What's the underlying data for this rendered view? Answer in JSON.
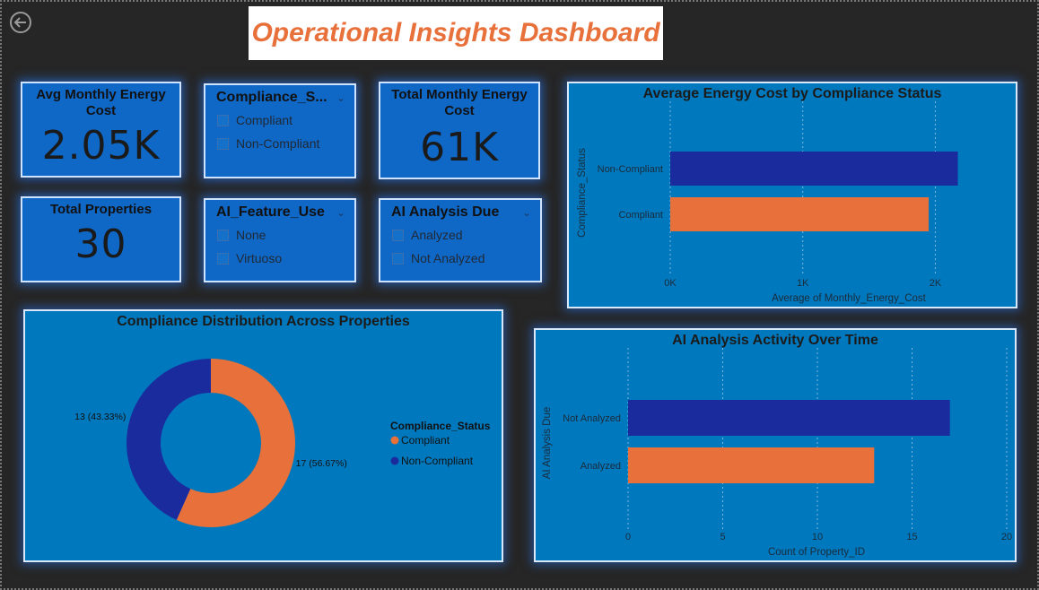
{
  "page_title": "Operational Insights Dashboard",
  "kpis": {
    "avg_energy": {
      "label": "Avg Monthly Energy Cost",
      "value": "2.05K"
    },
    "total_energy": {
      "label": "Total Monthly Energy Cost",
      "value": "61K"
    },
    "total_properties": {
      "label": "Total Properties",
      "value": "30"
    }
  },
  "slicers": {
    "compliance": {
      "title": "Compliance_S...",
      "options": [
        "Compliant",
        "Non-Compliant"
      ]
    },
    "ai_feature": {
      "title": "AI_Feature_Use",
      "options": [
        "None",
        "Virtuoso"
      ]
    },
    "ai_due": {
      "title": "AI Analysis Due",
      "options": [
        "Analyzed",
        "Not Analyzed"
      ]
    }
  },
  "colors": {
    "orange": "#e8703a",
    "navy": "#1a2b9e",
    "visual_bg": "#0078bd",
    "card_bg": "#0f67c6"
  },
  "chart_data": [
    {
      "type": "bar",
      "orientation": "horizontal",
      "title": "Average Energy Cost by Compliance Status",
      "xlabel": "Average of Monthly_Energy_Cost",
      "ylabel": "Compliance_Status",
      "categories": [
        "Non-Compliant",
        "Compliant"
      ],
      "values": [
        2170,
        1950
      ],
      "colors": [
        "#1a2b9e",
        "#e8703a"
      ],
      "xticks": [
        "0K",
        "1K",
        "2K"
      ],
      "xtick_values": [
        0,
        1000,
        2000
      ],
      "xlim": [
        0,
        2200
      ],
      "grid": true
    },
    {
      "type": "pie",
      "donut": true,
      "title": "Compliance Distribution Across Properties",
      "legend_title": "Compliance_Status",
      "legend_position": "right",
      "categories": [
        "Compliant",
        "Non-Compliant"
      ],
      "values": [
        17,
        13
      ],
      "labels": [
        "17 (56.67%)",
        "13 (43.33%)"
      ],
      "colors": [
        "#e8703a",
        "#1a2b9e"
      ]
    },
    {
      "type": "bar",
      "orientation": "horizontal",
      "title": "AI Analysis Activity Over Time",
      "xlabel": "Count of Property_ID",
      "ylabel": "AI Analysis Due",
      "categories": [
        "Not Analyzed",
        "Analyzed"
      ],
      "values": [
        17,
        13
      ],
      "colors": [
        "#1a2b9e",
        "#e8703a"
      ],
      "xticks": [
        "0",
        "5",
        "10",
        "15",
        "20"
      ],
      "xtick_values": [
        0,
        5,
        10,
        15,
        20
      ],
      "xlim": [
        0,
        20
      ],
      "grid": true
    }
  ]
}
